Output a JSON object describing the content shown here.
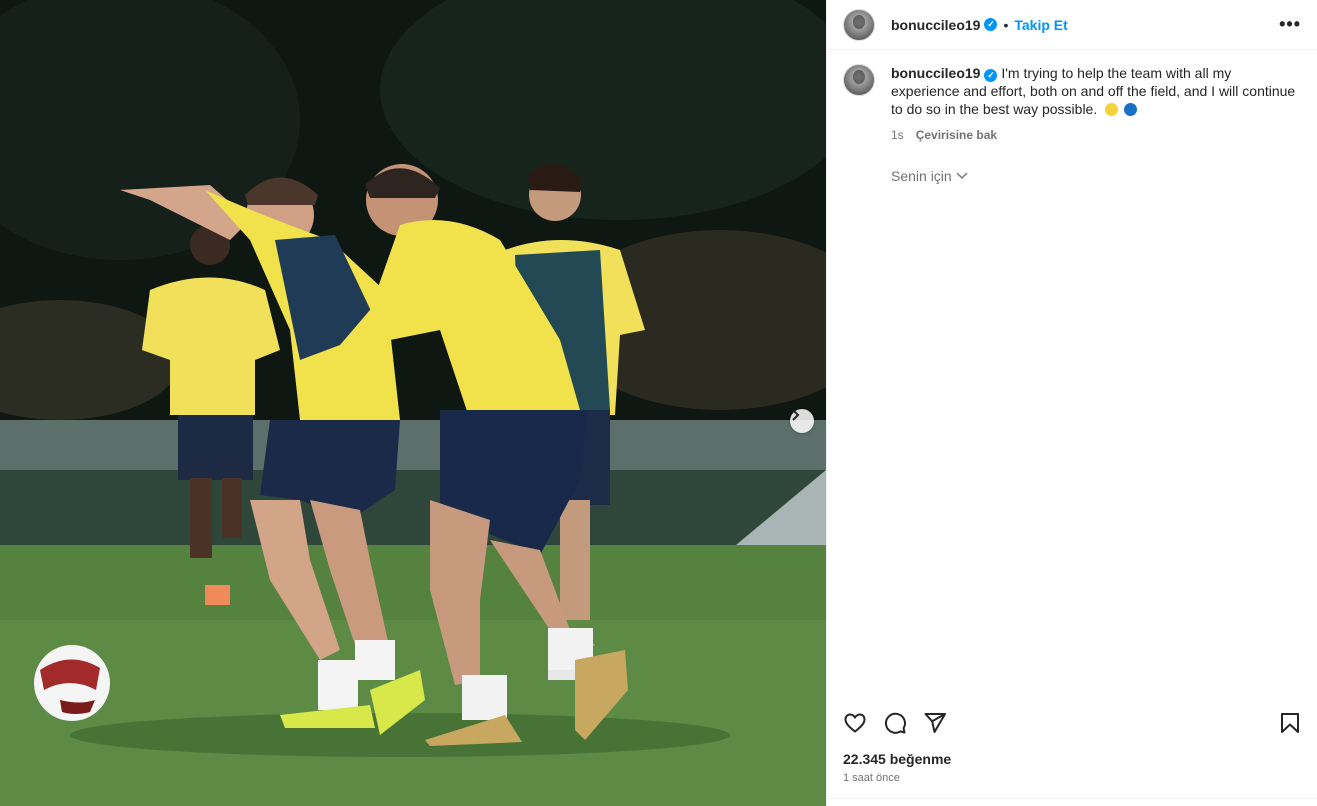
{
  "post": {
    "username": "bonuccileo19",
    "verified_mark": "✓",
    "separator": "•",
    "follow_label": "Takip Et",
    "more_label": "•••",
    "caption": {
      "username": "bonuccileo19",
      "text": "I'm trying to help the team with all my experience and effort, both on and off the field, and I will continue to do so in the best way possible.",
      "emojis": [
        "yellow-circle",
        "blue-circle"
      ]
    },
    "caption_age": "1s",
    "see_translation": "Çevirisine bak",
    "for_you_label": "Senin için",
    "likes": "22.345 beğenme",
    "posted_ago": "1 saat önce"
  },
  "icons": {
    "like": "heart-icon",
    "comment": "comment-icon",
    "share": "paper-plane-icon",
    "save": "bookmark-icon",
    "next": "chevron-right-icon",
    "dropdown": "chevron-down-icon"
  },
  "colors": {
    "accent": "#0095f6",
    "text": "#262626",
    "secondary": "#737373",
    "divider": "#efefef",
    "emoji_yellow": "#f5d23a",
    "emoji_blue": "#1a6fc9"
  }
}
